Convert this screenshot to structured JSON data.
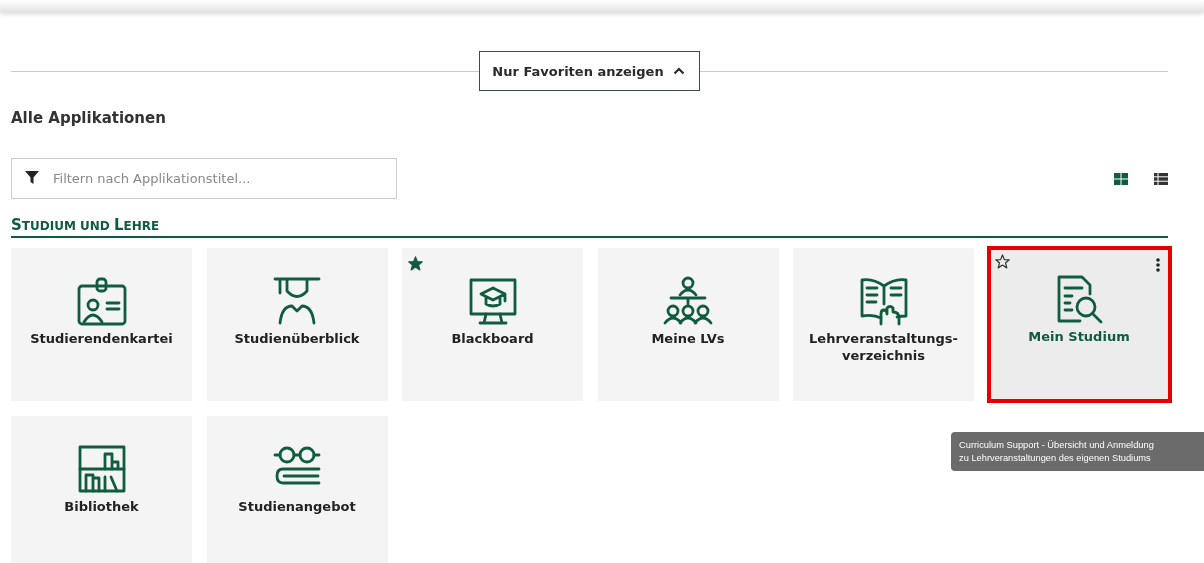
{
  "favorites_toggle": {
    "label": "Nur Favoriten anzeigen",
    "expanded": true
  },
  "heading": "Alle Applikationen",
  "filter": {
    "placeholder": "Filtern nach Applikationstitel..."
  },
  "view_toggle": [
    {
      "kind": "grid",
      "selected": true
    },
    {
      "kind": "list",
      "selected": false
    }
  ],
  "section": {
    "title_parts": [
      "S",
      "TUDIUM UND ",
      "L",
      "EHRE"
    ]
  },
  "tiles": [
    {
      "label": "Studierendenkartei",
      "kind": "id-card",
      "favorite": false,
      "hovered": false
    },
    {
      "label": "Studienüberblick",
      "kind": "graduate",
      "favorite": false,
      "hovered": false
    },
    {
      "label": "Blackboard",
      "kind": "monitor",
      "favorite": true,
      "hovered": false
    },
    {
      "label": "Meine LVs",
      "kind": "group",
      "favorite": false,
      "hovered": false
    },
    {
      "label": "Lehrveranstaltungs-verzeichnis",
      "kind": "book",
      "favorite": false,
      "hovered": false
    },
    {
      "label": "Mein Studium",
      "kind": "doc-search",
      "favorite": false,
      "hovered": true
    },
    {
      "label": "Bibliothek",
      "kind": "shelf",
      "favorite": false,
      "hovered": false
    },
    {
      "label": "Studienangebot",
      "kind": "glasses",
      "favorite": false,
      "hovered": false
    }
  ],
  "tooltip": {
    "lines": [
      "Curriculum Support - Übersicht und Anmeldung",
      "zu Lehrveranstaltungen des eigenen Studiums"
    ]
  }
}
